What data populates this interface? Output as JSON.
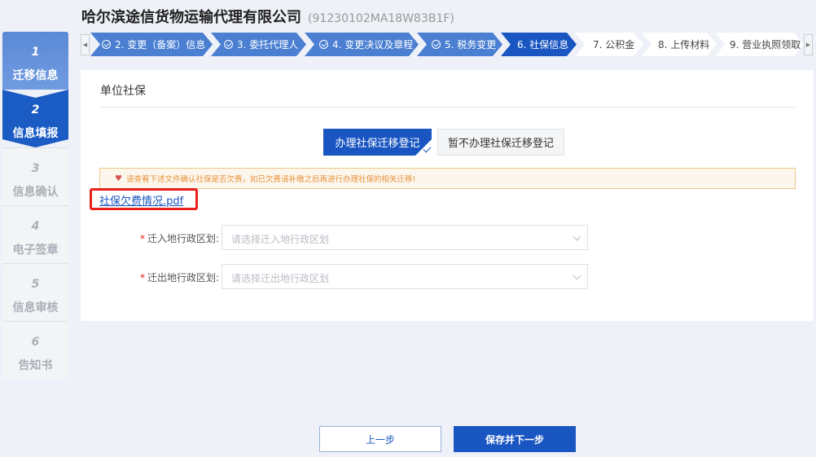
{
  "header": {
    "company_name": "哈尔滨途信货物运输代理有限公司",
    "credit_code": "(91230102MA18W83B1F)"
  },
  "sidebar": {
    "steps": [
      {
        "num": "1",
        "label": "迁移信息",
        "state": "done"
      },
      {
        "num": "2",
        "label": "信息填报",
        "state": "active"
      },
      {
        "num": "3",
        "label": "信息确认",
        "state": "todo"
      },
      {
        "num": "4",
        "label": "电子签章",
        "state": "todo"
      },
      {
        "num": "5",
        "label": "信息审核",
        "state": "todo"
      },
      {
        "num": "6",
        "label": "告知书",
        "state": "todo"
      }
    ]
  },
  "stepbar": {
    "left_arrow": "◀",
    "right_arrow": "▶",
    "steps": [
      {
        "label": "2. 变更（备案）信息",
        "state": "done"
      },
      {
        "label": "3. 委托代理人",
        "state": "done"
      },
      {
        "label": "4. 变更决议及章程",
        "state": "done"
      },
      {
        "label": "5. 税务变更",
        "state": "done"
      },
      {
        "label": "6. 社保信息",
        "state": "active"
      },
      {
        "label": "7. 公积金",
        "state": "todo"
      },
      {
        "label": "8. 上传材料",
        "state": "todo"
      },
      {
        "label": "9. 营业执照领取",
        "state": "todo"
      }
    ]
  },
  "panel": {
    "title": "单位社保",
    "option_handle": "办理社保迁移登记",
    "option_skip": "暂不办理社保迁移登记",
    "selected_option": "办理社保迁移登记",
    "notice_icon": "♥",
    "notice_text": "请查看下述文件确认社保是否欠费，如已欠费请补缴之后再进行办理社保的相关迁移!",
    "pdf_link": "社保欠费情况.pdf",
    "required_mark": "*",
    "fields": [
      {
        "label": "迁入地行政区划:",
        "placeholder": "请选择迁入地行政区划"
      },
      {
        "label": "迁出地行政区划:",
        "placeholder": "请选择迁出地行政区划"
      }
    ]
  },
  "footer": {
    "prev_label": "上一步",
    "next_label": "保存并下一步"
  },
  "colors": {
    "primary": "#1a56c2",
    "step_done": "#4a7fd1",
    "highlight": "#e8211a",
    "notice_bg": "#fdf6ec",
    "notice_text": "#e6913a"
  }
}
